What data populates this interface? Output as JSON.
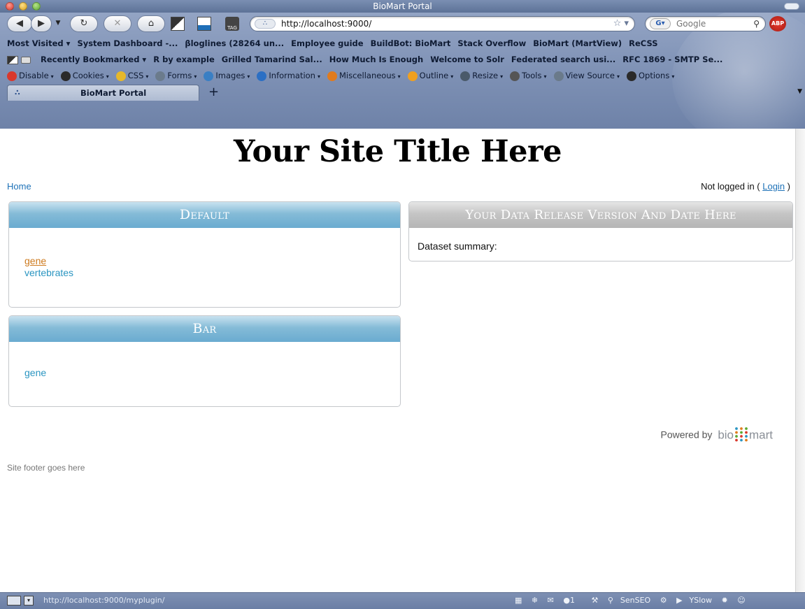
{
  "window": {
    "title": "BioMart Portal"
  },
  "toolbar": {
    "url": "http://localhost:9000/",
    "search_placeholder": "Google",
    "abp_label": "ABP",
    "tag_label": "TAG"
  },
  "bookmarks_row1": [
    "Most Visited ▾",
    "System Dashboard -...",
    "βloglines (28264 un...",
    "Employee guide",
    "BuildBot: BioMart",
    "Stack Overflow",
    "BioMart (MartView)",
    "ReCSS"
  ],
  "bookmarks_row2": [
    "Recently Bookmarked ▾",
    "R by example",
    "Grilled Tamarind Sal...",
    "How Much Is Enough",
    "Welcome to Solr",
    "Federated search usi...",
    "RFC 1869 - SMTP Se..."
  ],
  "dev_toolbar": [
    {
      "label": "Disable",
      "color": "#d9382c"
    },
    {
      "label": "Cookies",
      "color": "#2a2a2a"
    },
    {
      "label": "CSS",
      "color": "#e6b82a"
    },
    {
      "label": "Forms",
      "color": "#6b7b8c"
    },
    {
      "label": "Images",
      "color": "#3a7fc4"
    },
    {
      "label": "Information",
      "color": "#2b6fc4"
    },
    {
      "label": "Miscellaneous",
      "color": "#e07b1e"
    },
    {
      "label": "Outline",
      "color": "#f0a020"
    },
    {
      "label": "Resize",
      "color": "#4a5a6a"
    },
    {
      "label": "Tools",
      "color": "#555555"
    },
    {
      "label": "View Source",
      "color": "#6a7a8a"
    },
    {
      "label": "Options",
      "color": "#2a2a2a"
    }
  ],
  "tabs": [
    {
      "label": "BioMart Portal",
      "active": true
    }
  ],
  "page": {
    "site_title": "Your Site Title Here",
    "home_link": "Home",
    "login_prefix": "Not logged in ( ",
    "login_link": "Login",
    "login_suffix": " )",
    "panels": {
      "default": {
        "title": "Default",
        "items": [
          {
            "label": "gene",
            "visited": true
          },
          {
            "label": "vertebrates",
            "visited": false
          }
        ]
      },
      "bar": {
        "title": "Bar",
        "items": [
          {
            "label": "gene",
            "visited": false
          }
        ]
      },
      "release": {
        "title": "Your Data Release Version And Date Here",
        "summary_label": "Dataset summary:"
      }
    },
    "powered_by": "Powered by",
    "logo_left": "bio",
    "logo_right": "mart",
    "footer": "Site footer goes here"
  },
  "statusbar": {
    "url": "http://localhost:9000/myplugin/",
    "badge_count": "1",
    "senseo": "SenSEO",
    "yslow": "YSlow"
  },
  "colors": {
    "link": "#1e72b8",
    "panel_link": "#2a95c1",
    "visited": "#cd7a1e",
    "panel_blue": "#84bbd7",
    "panel_grey": "#c5c5c5"
  }
}
